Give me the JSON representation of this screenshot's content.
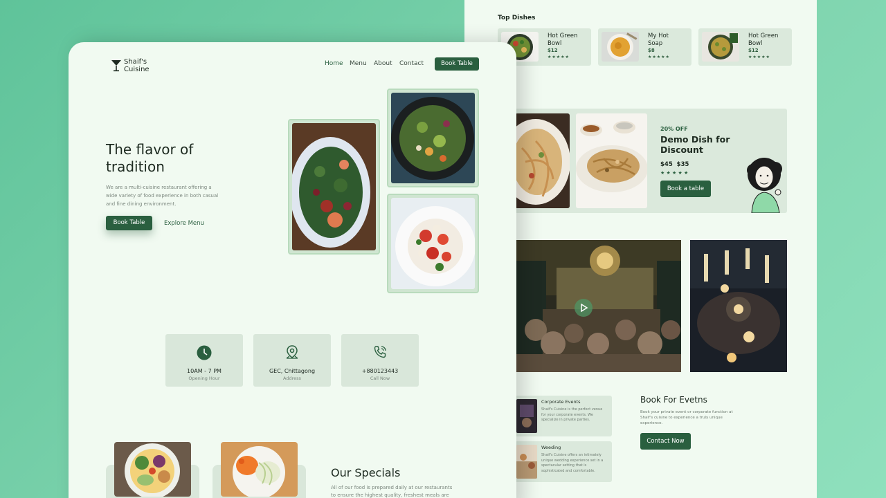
{
  "left": {
    "brand": {
      "line1": "Shaif's",
      "line2": "Cuisine"
    },
    "nav": {
      "home": "Home",
      "menu": "Menu",
      "about": "About",
      "contact": "Contact",
      "cta": "Book Table"
    },
    "hero": {
      "title_line1": "The flavor of",
      "title_line2": "tradition",
      "desc_line1": "We are a multi-cuisine restaurant offering a",
      "desc_line2": "wide variety of food experience in both casual",
      "desc_line3": "and fine dining environment.",
      "primary_btn": "Book Table",
      "secondary_btn": "Explore Menu"
    },
    "info": [
      {
        "title": "10AM - 7 PM",
        "sub": "Opening Hour",
        "icon": "clock-icon"
      },
      {
        "title": "GEC, Chittagong",
        "sub": "Address",
        "icon": "location-pin-icon"
      },
      {
        "title": "+880123443",
        "sub": "Call Now",
        "icon": "phone-icon"
      }
    ],
    "specials": {
      "title": "Our Specials",
      "desc_line1": "All of our food is prepared daily at our restaurants",
      "desc_line2": "to ensure the highest quality, freshest meals are"
    }
  },
  "right": {
    "top_dishes": {
      "heading": "Top Dishes",
      "items": [
        {
          "name_line1": "Hot Green",
          "name_line2": "Bowl",
          "price": "$12",
          "stars": "★★★★★"
        },
        {
          "name_line1": "My Hot",
          "name_line2": "Soap",
          "price": "$8",
          "stars": "★★★★★"
        },
        {
          "name_line1": "Hot Green",
          "name_line2": "Bowl",
          "price": "$12",
          "stars": "★★★★★"
        }
      ]
    },
    "promo": {
      "discount": "20% OFF",
      "title_line1": "Demo Dish for",
      "title_line2": "Discount",
      "price_old": "$45",
      "price_new": "$35",
      "stars": "★ ★ ★ ★ ★",
      "button": "Book a table"
    },
    "events": {
      "title": "Book For Evetns",
      "desc_line1": "Book your private event or corporate function at",
      "desc_line2": "Shaif's cuisine to experience a truly unique",
      "desc_line3": "experience.",
      "button": "Contact Now",
      "items": [
        {
          "title": "Corporate Events",
          "line1": "Shaif's Cuisine is the perfect venue",
          "line2": "for your corporate events. We",
          "line3": "specialize in private parties.",
          "line4": ""
        },
        {
          "title": "Weeding",
          "line1": "Shaif's Cuisine offers an intimately",
          "line2": "unique wedding experience set in a",
          "line3": "spectacular setting that is",
          "line4": "sophisticated and comfortable."
        }
      ]
    }
  },
  "colors": {
    "accent": "#2a5f3f",
    "page_bg": "#f1faf1",
    "card_bg": "#dbe9dc",
    "backdrop": "#6fcca3"
  }
}
